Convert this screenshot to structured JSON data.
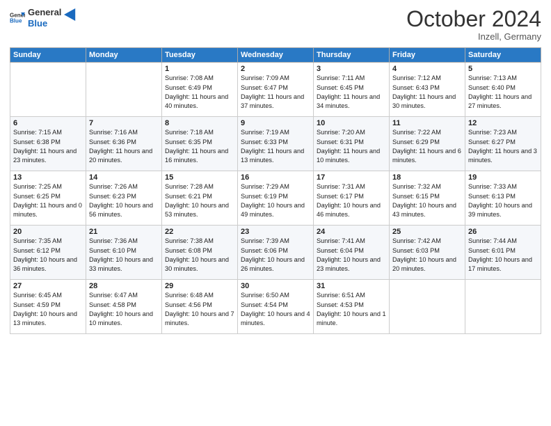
{
  "logo": {
    "line1": "General",
    "line2": "Blue"
  },
  "title": "October 2024",
  "location": "Inzell, Germany",
  "days_of_week": [
    "Sunday",
    "Monday",
    "Tuesday",
    "Wednesday",
    "Thursday",
    "Friday",
    "Saturday"
  ],
  "weeks": [
    [
      {
        "day": "",
        "sunrise": "",
        "sunset": "",
        "daylight": ""
      },
      {
        "day": "",
        "sunrise": "",
        "sunset": "",
        "daylight": ""
      },
      {
        "day": "1",
        "sunrise": "Sunrise: 7:08 AM",
        "sunset": "Sunset: 6:49 PM",
        "daylight": "Daylight: 11 hours and 40 minutes."
      },
      {
        "day": "2",
        "sunrise": "Sunrise: 7:09 AM",
        "sunset": "Sunset: 6:47 PM",
        "daylight": "Daylight: 11 hours and 37 minutes."
      },
      {
        "day": "3",
        "sunrise": "Sunrise: 7:11 AM",
        "sunset": "Sunset: 6:45 PM",
        "daylight": "Daylight: 11 hours and 34 minutes."
      },
      {
        "day": "4",
        "sunrise": "Sunrise: 7:12 AM",
        "sunset": "Sunset: 6:43 PM",
        "daylight": "Daylight: 11 hours and 30 minutes."
      },
      {
        "day": "5",
        "sunrise": "Sunrise: 7:13 AM",
        "sunset": "Sunset: 6:40 PM",
        "daylight": "Daylight: 11 hours and 27 minutes."
      }
    ],
    [
      {
        "day": "6",
        "sunrise": "Sunrise: 7:15 AM",
        "sunset": "Sunset: 6:38 PM",
        "daylight": "Daylight: 11 hours and 23 minutes."
      },
      {
        "day": "7",
        "sunrise": "Sunrise: 7:16 AM",
        "sunset": "Sunset: 6:36 PM",
        "daylight": "Daylight: 11 hours and 20 minutes."
      },
      {
        "day": "8",
        "sunrise": "Sunrise: 7:18 AM",
        "sunset": "Sunset: 6:35 PM",
        "daylight": "Daylight: 11 hours and 16 minutes."
      },
      {
        "day": "9",
        "sunrise": "Sunrise: 7:19 AM",
        "sunset": "Sunset: 6:33 PM",
        "daylight": "Daylight: 11 hours and 13 minutes."
      },
      {
        "day": "10",
        "sunrise": "Sunrise: 7:20 AM",
        "sunset": "Sunset: 6:31 PM",
        "daylight": "Daylight: 11 hours and 10 minutes."
      },
      {
        "day": "11",
        "sunrise": "Sunrise: 7:22 AM",
        "sunset": "Sunset: 6:29 PM",
        "daylight": "Daylight: 11 hours and 6 minutes."
      },
      {
        "day": "12",
        "sunrise": "Sunrise: 7:23 AM",
        "sunset": "Sunset: 6:27 PM",
        "daylight": "Daylight: 11 hours and 3 minutes."
      }
    ],
    [
      {
        "day": "13",
        "sunrise": "Sunrise: 7:25 AM",
        "sunset": "Sunset: 6:25 PM",
        "daylight": "Daylight: 11 hours and 0 minutes."
      },
      {
        "day": "14",
        "sunrise": "Sunrise: 7:26 AM",
        "sunset": "Sunset: 6:23 PM",
        "daylight": "Daylight: 10 hours and 56 minutes."
      },
      {
        "day": "15",
        "sunrise": "Sunrise: 7:28 AM",
        "sunset": "Sunset: 6:21 PM",
        "daylight": "Daylight: 10 hours and 53 minutes."
      },
      {
        "day": "16",
        "sunrise": "Sunrise: 7:29 AM",
        "sunset": "Sunset: 6:19 PM",
        "daylight": "Daylight: 10 hours and 49 minutes."
      },
      {
        "day": "17",
        "sunrise": "Sunrise: 7:31 AM",
        "sunset": "Sunset: 6:17 PM",
        "daylight": "Daylight: 10 hours and 46 minutes."
      },
      {
        "day": "18",
        "sunrise": "Sunrise: 7:32 AM",
        "sunset": "Sunset: 6:15 PM",
        "daylight": "Daylight: 10 hours and 43 minutes."
      },
      {
        "day": "19",
        "sunrise": "Sunrise: 7:33 AM",
        "sunset": "Sunset: 6:13 PM",
        "daylight": "Daylight: 10 hours and 39 minutes."
      }
    ],
    [
      {
        "day": "20",
        "sunrise": "Sunrise: 7:35 AM",
        "sunset": "Sunset: 6:12 PM",
        "daylight": "Daylight: 10 hours and 36 minutes."
      },
      {
        "day": "21",
        "sunrise": "Sunrise: 7:36 AM",
        "sunset": "Sunset: 6:10 PM",
        "daylight": "Daylight: 10 hours and 33 minutes."
      },
      {
        "day": "22",
        "sunrise": "Sunrise: 7:38 AM",
        "sunset": "Sunset: 6:08 PM",
        "daylight": "Daylight: 10 hours and 30 minutes."
      },
      {
        "day": "23",
        "sunrise": "Sunrise: 7:39 AM",
        "sunset": "Sunset: 6:06 PM",
        "daylight": "Daylight: 10 hours and 26 minutes."
      },
      {
        "day": "24",
        "sunrise": "Sunrise: 7:41 AM",
        "sunset": "Sunset: 6:04 PM",
        "daylight": "Daylight: 10 hours and 23 minutes."
      },
      {
        "day": "25",
        "sunrise": "Sunrise: 7:42 AM",
        "sunset": "Sunset: 6:03 PM",
        "daylight": "Daylight: 10 hours and 20 minutes."
      },
      {
        "day": "26",
        "sunrise": "Sunrise: 7:44 AM",
        "sunset": "Sunset: 6:01 PM",
        "daylight": "Daylight: 10 hours and 17 minutes."
      }
    ],
    [
      {
        "day": "27",
        "sunrise": "Sunrise: 6:45 AM",
        "sunset": "Sunset: 4:59 PM",
        "daylight": "Daylight: 10 hours and 13 minutes."
      },
      {
        "day": "28",
        "sunrise": "Sunrise: 6:47 AM",
        "sunset": "Sunset: 4:58 PM",
        "daylight": "Daylight: 10 hours and 10 minutes."
      },
      {
        "day": "29",
        "sunrise": "Sunrise: 6:48 AM",
        "sunset": "Sunset: 4:56 PM",
        "daylight": "Daylight: 10 hours and 7 minutes."
      },
      {
        "day": "30",
        "sunrise": "Sunrise: 6:50 AM",
        "sunset": "Sunset: 4:54 PM",
        "daylight": "Daylight: 10 hours and 4 minutes."
      },
      {
        "day": "31",
        "sunrise": "Sunrise: 6:51 AM",
        "sunset": "Sunset: 4:53 PM",
        "daylight": "Daylight: 10 hours and 1 minute."
      },
      {
        "day": "",
        "sunrise": "",
        "sunset": "",
        "daylight": ""
      },
      {
        "day": "",
        "sunrise": "",
        "sunset": "",
        "daylight": ""
      }
    ]
  ]
}
